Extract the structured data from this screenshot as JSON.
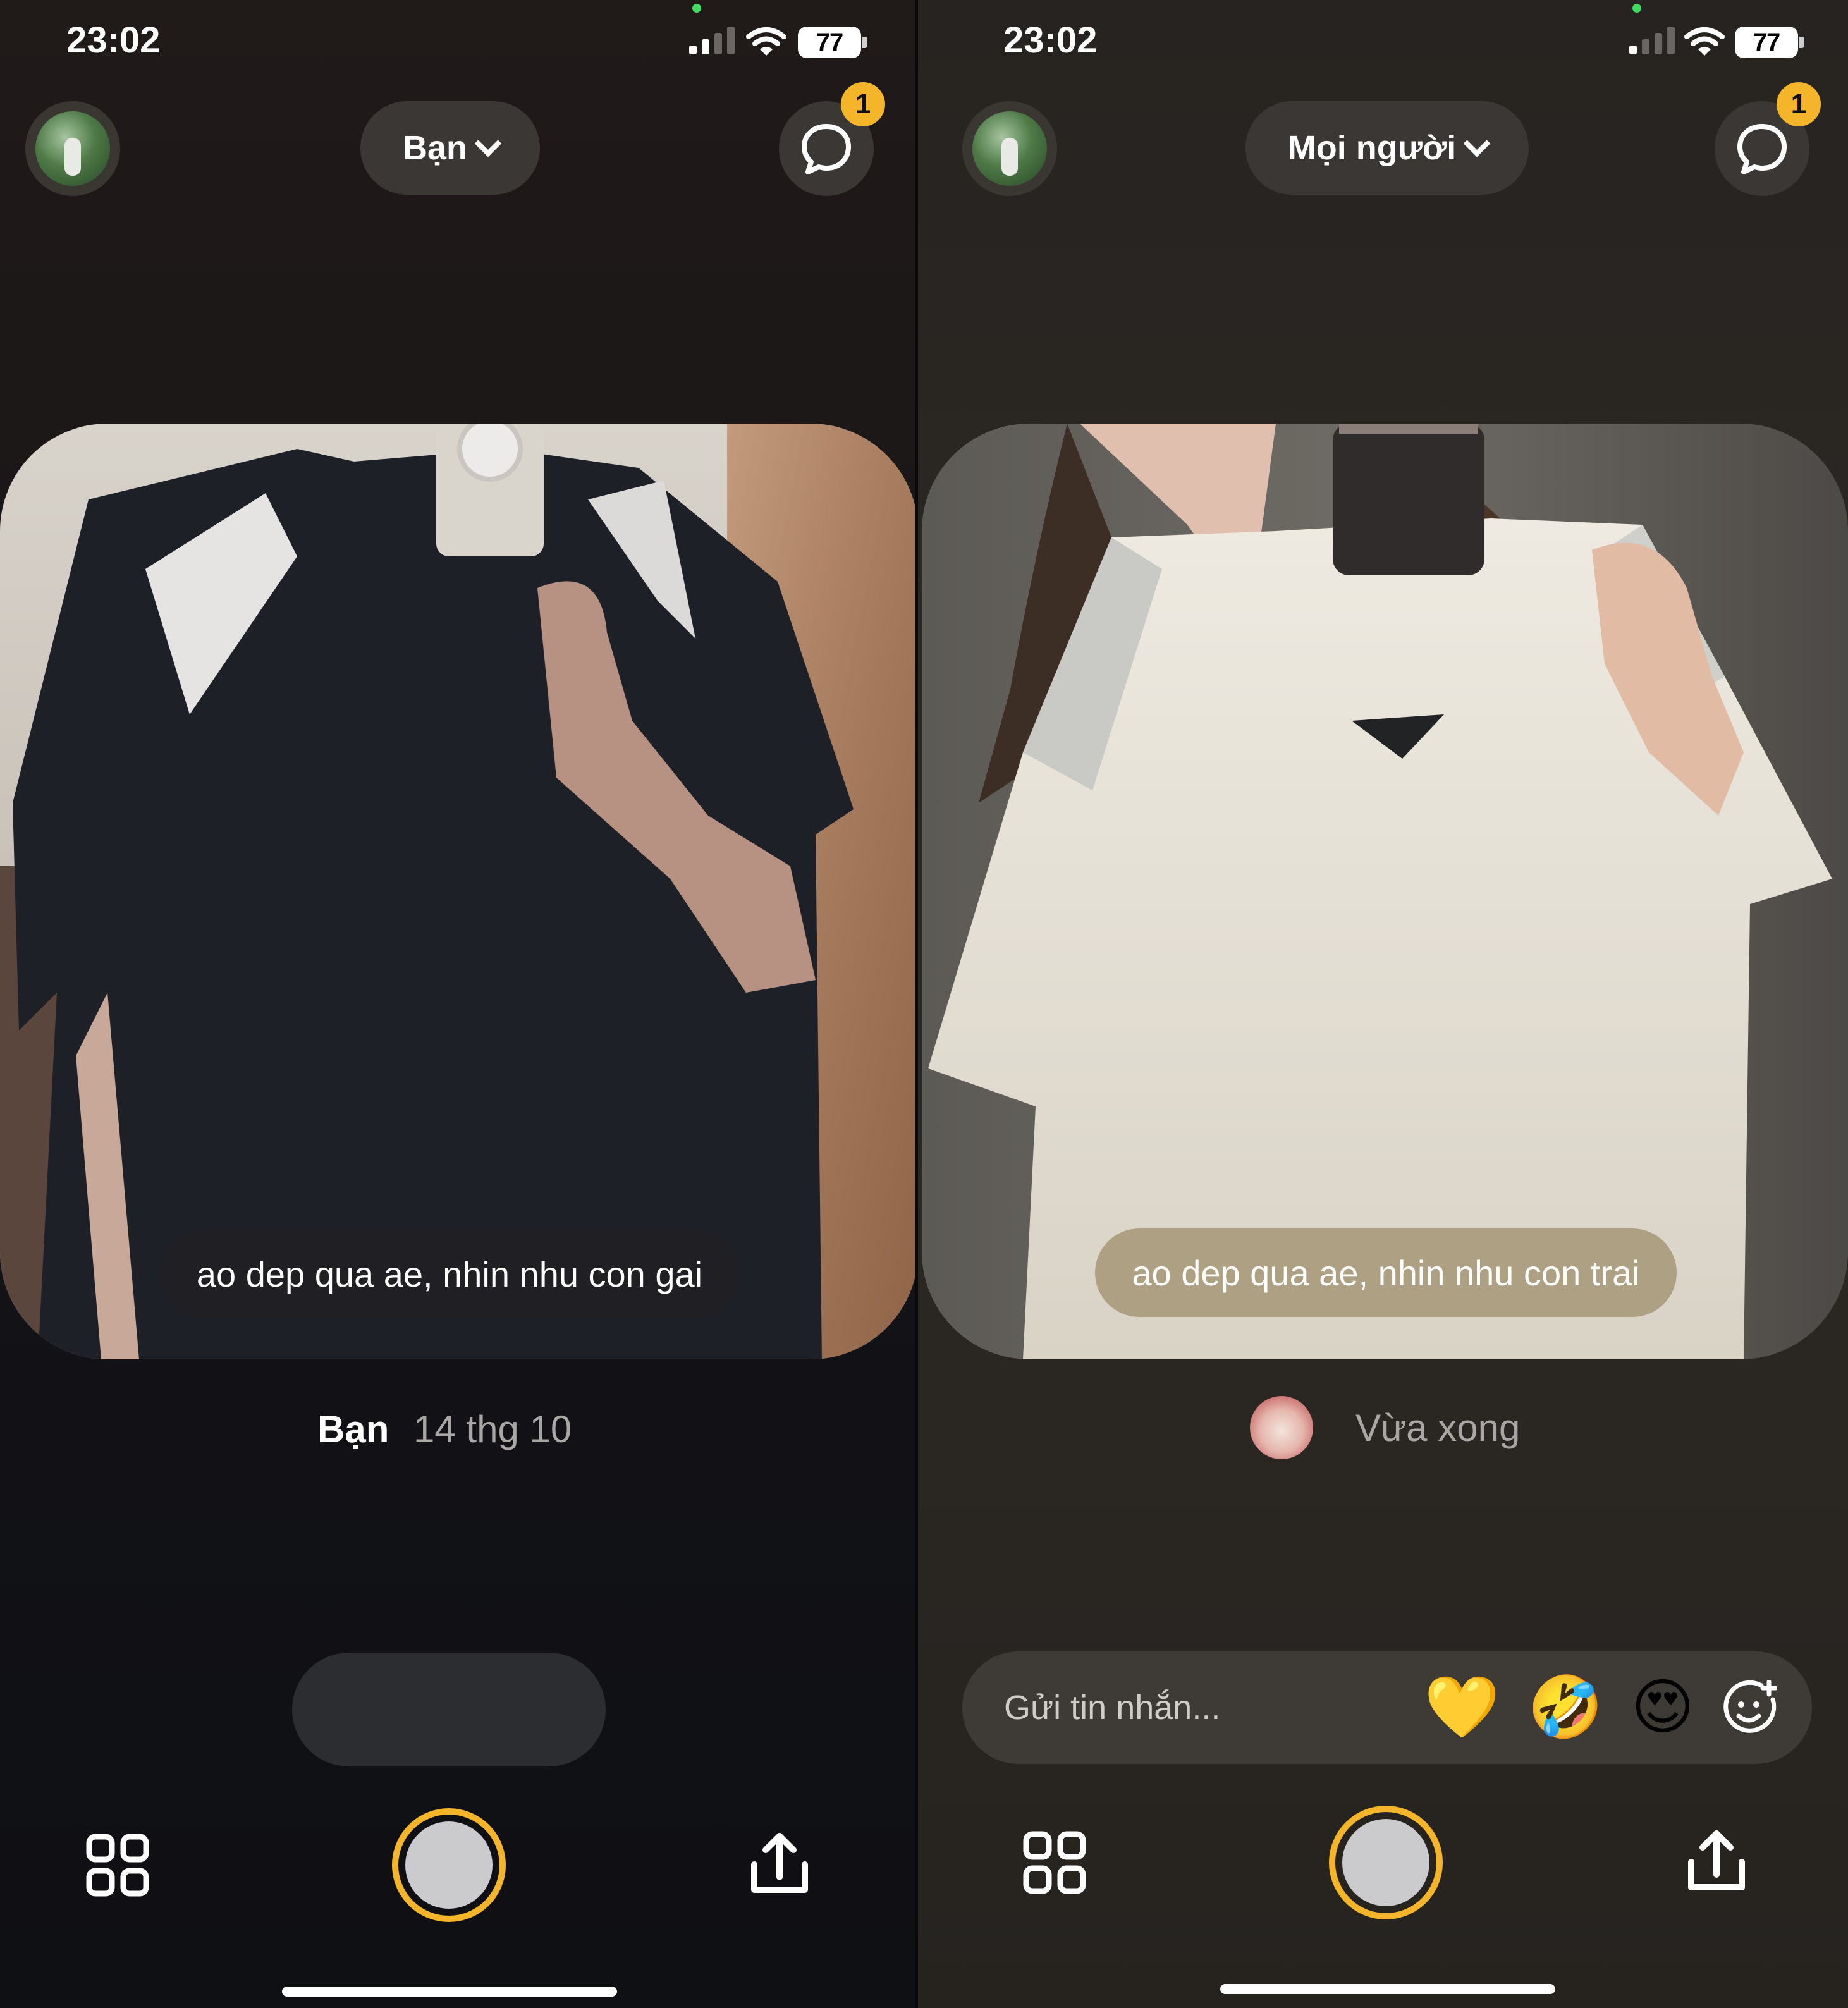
{
  "status_bar": {
    "time": "23:02",
    "battery": "77"
  },
  "left_screen": {
    "audience_selector": {
      "label": "Bạn"
    },
    "messages_badge": "1",
    "post": {
      "caption": "ao dep qua ae, nhin nhu con gai",
      "author": "Bạn",
      "date": "14 thg 10"
    }
  },
  "right_screen": {
    "audience_selector": {
      "label": "Mọi người"
    },
    "messages_badge": "1",
    "post": {
      "caption": "ao dep qua ae, nhin nhu con trai",
      "time": "Vừa xong"
    },
    "message_bar": {
      "placeholder": "Gửi tin nhắn...",
      "reactions": [
        {
          "icon": "yellow-heart-icon",
          "glyph": "💛"
        },
        {
          "icon": "rolling-laughing-icon",
          "glyph": "🤣"
        },
        {
          "icon": "heart-eyes-icon",
          "glyph": "😍"
        }
      ],
      "add_reaction_icon": "add-emoji-icon"
    }
  },
  "colors": {
    "accent": "#f4b52a",
    "shutter_fill": "#cbcbcd"
  },
  "icons": [
    "avatar",
    "chevron-down-icon",
    "chat-bubble-icon",
    "grid-icon",
    "shutter-button",
    "share-icon"
  ]
}
